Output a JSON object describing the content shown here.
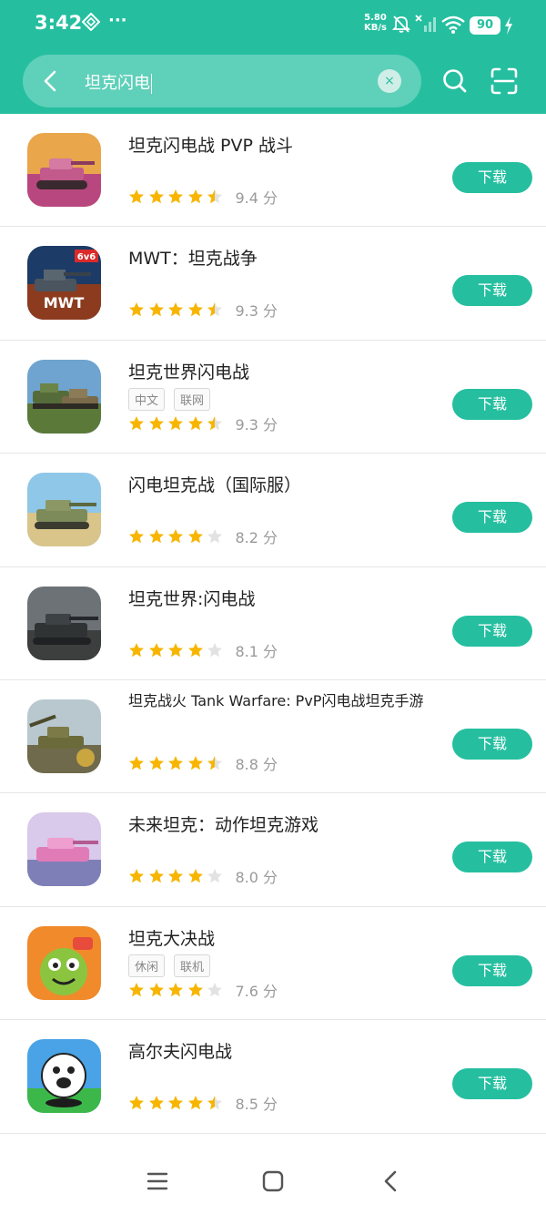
{
  "status": {
    "time": "3:42",
    "net_speed": "5.80",
    "net_unit": "KB/s",
    "battery": "90"
  },
  "search": {
    "query": "坦克闪电",
    "clear_glyph": "×"
  },
  "colors": {
    "accent": "#25bfa0",
    "star": "#f7b500",
    "star_empty": "#e2e2e2"
  },
  "icons": [
    "back-icon",
    "clear-icon",
    "search-icon",
    "scan-icon",
    "menu-icon",
    "home-icon",
    "nav-back-icon"
  ],
  "apps": [
    {
      "name": "坦克闪电战 PVP 战斗",
      "tags": [],
      "stars": 4.5,
      "score": "9.4 分",
      "button": "下载"
    },
    {
      "name": "MWT：坦克战争",
      "tags": [],
      "stars": 4.5,
      "score": "9.3 分",
      "button": "下载"
    },
    {
      "name": "坦克世界闪电战",
      "tags": [
        "中文",
        "联网"
      ],
      "stars": 4.5,
      "score": "9.3 分",
      "button": "下载"
    },
    {
      "name": "闪电坦克战（国际服）",
      "tags": [],
      "stars": 4,
      "score": "8.2 分",
      "button": "下载"
    },
    {
      "name": "坦克世界:闪电战",
      "tags": [],
      "stars": 4,
      "score": "8.1 分",
      "button": "下载"
    },
    {
      "name": "坦克战火 Tank Warfare: PvP闪电战坦克手游",
      "tags": [],
      "stars": 4.5,
      "score": "8.8 分",
      "button": "下载"
    },
    {
      "name": "未来坦克：动作坦克游戏",
      "tags": [],
      "stars": 4,
      "score": "8.0 分",
      "button": "下载"
    },
    {
      "name": "坦克大决战",
      "tags": [
        "休闲",
        "联机"
      ],
      "stars": 4,
      "score": "7.6 分",
      "button": "下载"
    },
    {
      "name": "高尔夫闪电战",
      "tags": [],
      "stars": 4.5,
      "score": "8.5 分",
      "button": "下载"
    }
  ]
}
